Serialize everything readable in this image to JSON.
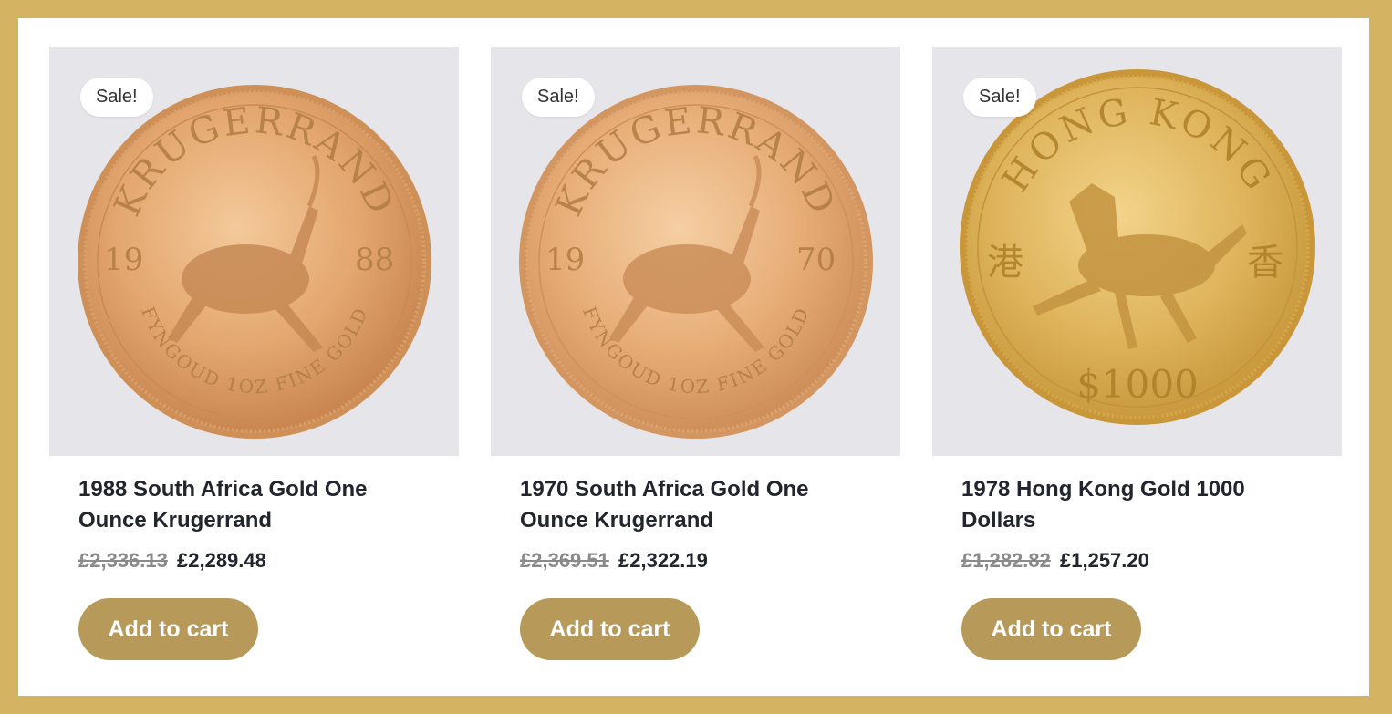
{
  "products": [
    {
      "sale_badge": "Sale!",
      "title": "1988 South Africa Gold One Ounce Krugerrand",
      "old_price": "£2,336.13",
      "new_price": "£2,289.48",
      "button_label": "Add to cart",
      "coin": {
        "top": "KRUGERRAND",
        "left": "19",
        "right": "88",
        "bottom": "FYNGOUD 1OZ FINE GOLD"
      }
    },
    {
      "sale_badge": "Sale!",
      "title": "1970 South Africa Gold One Ounce Krugerrand",
      "old_price": "£2,369.51",
      "new_price": "£2,322.19",
      "button_label": "Add to cart",
      "coin": {
        "top": "KRUGERRAND",
        "left": "19",
        "right": "70",
        "bottom": "FYNGOUD 1OZ FINE GOLD"
      }
    },
    {
      "sale_badge": "Sale!",
      "title": "1978 Hong Kong Gold 1000 Dollars",
      "old_price": "£1,282.82",
      "new_price": "£1,257.20",
      "button_label": "Add to cart",
      "coin": {
        "top": "HONG KONG",
        "left": "港",
        "right": "香",
        "bottom": "$1000"
      }
    }
  ],
  "colors": {
    "frame": "#d4b462",
    "button": "#b79a59",
    "image_bg": "#e6e5ea",
    "title_text": "#22252e",
    "old_price_text": "#8a8a8a"
  }
}
